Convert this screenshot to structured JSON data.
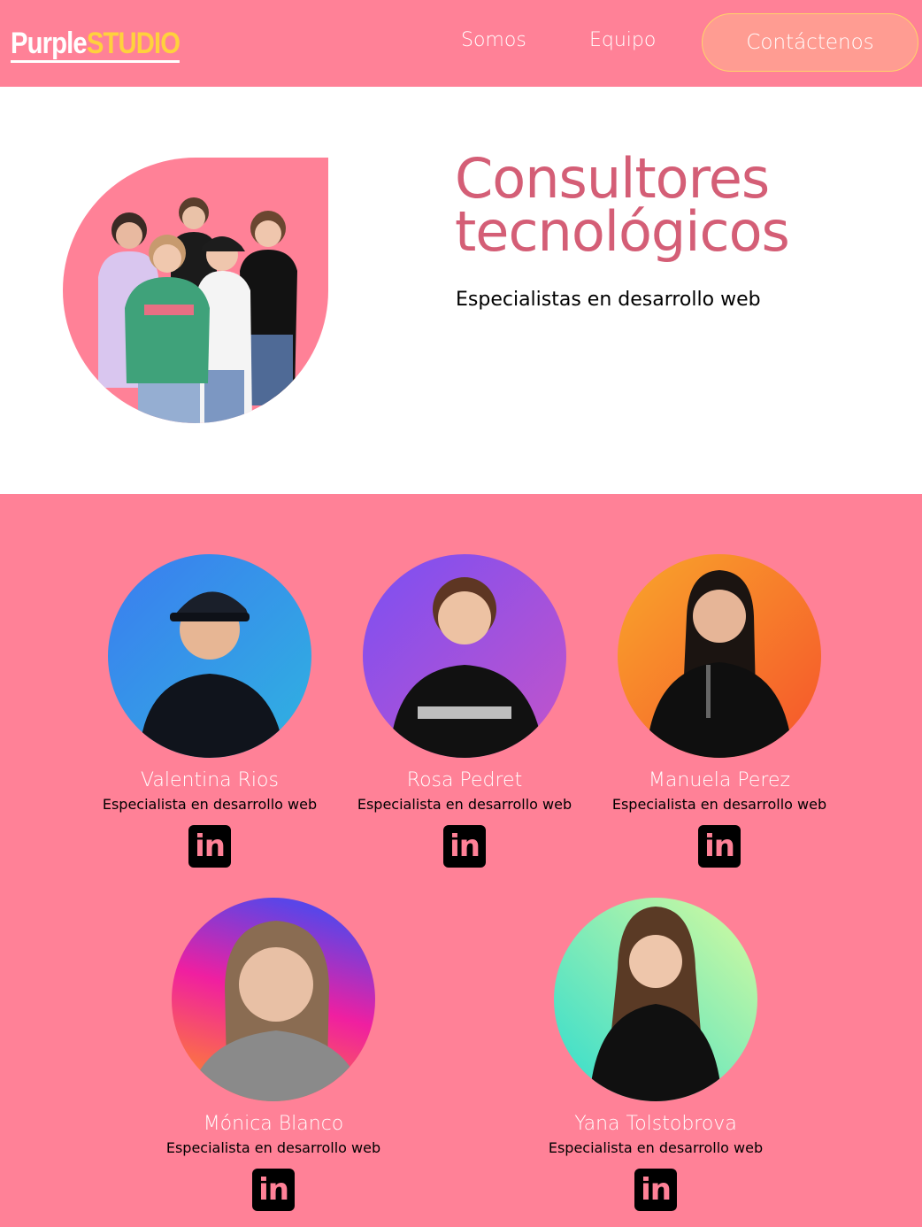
{
  "header": {
    "logo_part1": "Purple",
    "logo_part2": "STUDIO",
    "nav": [
      "Somos",
      "Equipo"
    ],
    "cta_label": "Contáctenos"
  },
  "hero": {
    "title": "Consultores tecnológicos",
    "subtitle": "Especialistas en desarrollo web",
    "image_icon": "team-photo"
  },
  "team": {
    "members": [
      {
        "name": "Valentina Rios",
        "role": "Especialista en desarrollo web",
        "social_icon": "linkedin-icon"
      },
      {
        "name": "Rosa Pedret",
        "role": "Especialista en desarrollo web",
        "social_icon": "linkedin-icon"
      },
      {
        "name": "Manuela Perez",
        "role": "Especialista en desarrollo web",
        "social_icon": "linkedin-icon"
      },
      {
        "name": "Mónica Blanco",
        "role": "Especialista en desarrollo web",
        "social_icon": "linkedin-icon"
      },
      {
        "name": "Yana Tolstobrova",
        "role": "Especialista en desarrollo web",
        "social_icon": "linkedin-icon"
      }
    ],
    "linkedin_glyph": "in"
  },
  "colors": {
    "primary_pink": "#ff8197",
    "title_rose": "#d45e76",
    "logo_yellow": "#ffd13d",
    "cta_bg": "#ff9c92"
  }
}
